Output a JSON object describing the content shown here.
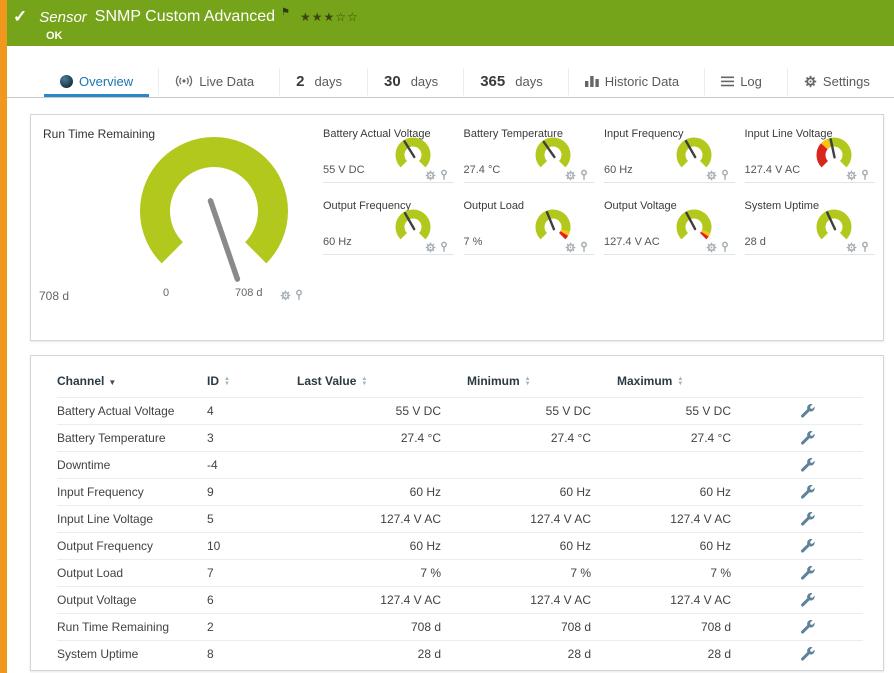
{
  "page": {
    "accent_color": "#f0971e",
    "status_color": "#75a319",
    "gauge_green": "#b2c81c",
    "gauge_yellow": "#ffc20e",
    "gauge_red": "#d8261d",
    "active_tab_color": "#1a76ad"
  },
  "header": {
    "kind": "Sensor",
    "title": "SNMP Custom Advanced",
    "status": "OK",
    "priority_stars": "★★★☆☆"
  },
  "icons": {
    "check": "✓",
    "flag": "⚑",
    "sort_active": "▼",
    "sort_up": "▲",
    "sort_down": "▼"
  },
  "tabs": {
    "overview": "Overview",
    "live_data": "Live Data",
    "days_2": {
      "num": "2",
      "unit": "days"
    },
    "days_30": {
      "num": "30",
      "unit": "days"
    },
    "days_365": {
      "num": "365",
      "unit": "days"
    },
    "historic": "Historic Data",
    "log": "Log",
    "settings": "Settings"
  },
  "gauges": {
    "main": {
      "title": "Run Time Remaining",
      "value": "708 d",
      "scale_min_label": "0",
      "scale_max_label": "708 d",
      "needle_deg": 71,
      "segments": [
        {
          "from": 135,
          "to": 405,
          "color": "#b2c81c"
        }
      ]
    },
    "small": [
      {
        "title": "Battery Actual Voltage",
        "value": "55 V DC",
        "needle_deg": 238,
        "segments": [
          {
            "from": 135,
            "to": 405,
            "color": "#b2c81c"
          }
        ]
      },
      {
        "title": "Battery Temperature",
        "value": "27.4 °C",
        "needle_deg": 235,
        "segments": [
          {
            "from": 135,
            "to": 405,
            "color": "#b2c81c"
          }
        ]
      },
      {
        "title": "Input Frequency",
        "value": "60 Hz",
        "needle_deg": 240,
        "segments": [
          {
            "from": 135,
            "to": 405,
            "color": "#b2c81c"
          }
        ]
      },
      {
        "title": "Input Line Voltage",
        "value": "127.4 V AC",
        "needle_deg": 258,
        "segments": [
          {
            "from": 135,
            "to": 222,
            "color": "#d8261d"
          },
          {
            "from": 222,
            "to": 247,
            "color": "#ffc20e"
          },
          {
            "from": 247,
            "to": 405,
            "color": "#b2c81c"
          }
        ]
      },
      {
        "title": "Output Frequency",
        "value": "60 Hz",
        "needle_deg": 240,
        "segments": [
          {
            "from": 135,
            "to": 405,
            "color": "#b2c81c"
          }
        ]
      },
      {
        "title": "Output Load",
        "value": "7 %",
        "needle_deg": 248,
        "segments": [
          {
            "from": 135,
            "to": 376,
            "color": "#b2c81c"
          },
          {
            "from": 376,
            "to": 390,
            "color": "#ffc20e"
          },
          {
            "from": 390,
            "to": 405,
            "color": "#d8261d"
          }
        ]
      },
      {
        "title": "Output Voltage",
        "value": "127.4 V AC",
        "needle_deg": 242,
        "segments": [
          {
            "from": 135,
            "to": 381,
            "color": "#b2c81c"
          },
          {
            "from": 381,
            "to": 393,
            "color": "#ffc20e"
          },
          {
            "from": 393,
            "to": 405,
            "color": "#d8261d"
          }
        ]
      },
      {
        "title": "System Uptime",
        "value": "28 d",
        "needle_deg": 245,
        "segments": [
          {
            "from": 135,
            "to": 405,
            "color": "#b2c81c"
          }
        ]
      }
    ]
  },
  "table": {
    "headers": {
      "channel": "Channel",
      "id": "ID",
      "last_value": "Last Value",
      "minimum": "Minimum",
      "maximum": "Maximum"
    },
    "rows": [
      {
        "channel": "Battery Actual Voltage",
        "id": "4",
        "last": "55 V DC",
        "min": "55 V DC",
        "max": "55 V DC"
      },
      {
        "channel": "Battery Temperature",
        "id": "3",
        "last": "27.4 °C",
        "min": "27.4 °C",
        "max": "27.4 °C"
      },
      {
        "channel": "Downtime",
        "id": "-4",
        "last": "",
        "min": "",
        "max": ""
      },
      {
        "channel": "Input Frequency",
        "id": "9",
        "last": "60 Hz",
        "min": "60 Hz",
        "max": "60 Hz"
      },
      {
        "channel": "Input Line Voltage",
        "id": "5",
        "last": "127.4 V AC",
        "min": "127.4 V AC",
        "max": "127.4 V AC"
      },
      {
        "channel": "Output Frequency",
        "id": "10",
        "last": "60 Hz",
        "min": "60 Hz",
        "max": "60 Hz"
      },
      {
        "channel": "Output Load",
        "id": "7",
        "last": "7 %",
        "min": "7 %",
        "max": "7 %"
      },
      {
        "channel": "Output Voltage",
        "id": "6",
        "last": "127.4 V AC",
        "min": "127.4 V AC",
        "max": "127.4 V AC"
      },
      {
        "channel": "Run Time Remaining",
        "id": "2",
        "last": "708 d",
        "min": "708 d",
        "max": "708 d"
      },
      {
        "channel": "System Uptime",
        "id": "8",
        "last": "28 d",
        "min": "28 d",
        "max": "28 d"
      }
    ]
  }
}
